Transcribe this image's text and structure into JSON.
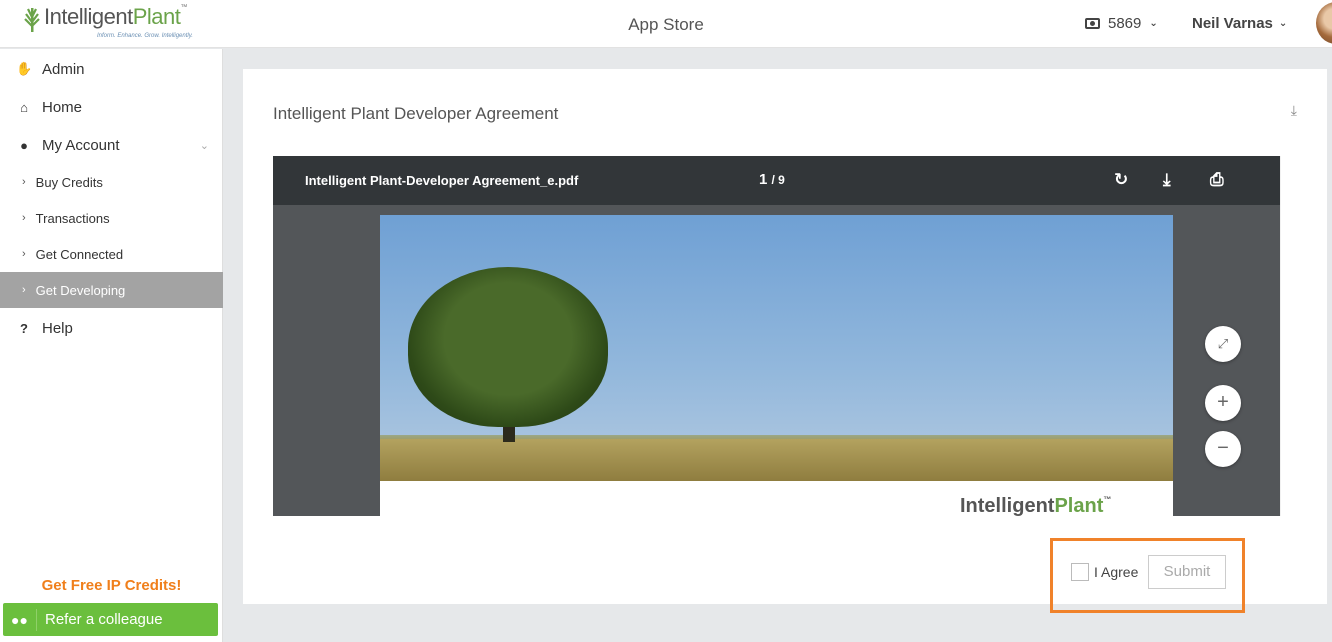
{
  "header": {
    "logo_name_1": "Intelligent",
    "logo_name_2": "Plant",
    "logo_tm": "™",
    "logo_tagline": "Inform. Enhance. Grow. Intelligently.",
    "title": "App Store",
    "credits": "5869",
    "user_name": "Neil Varnas"
  },
  "sidebar": {
    "items": [
      {
        "label": "Admin",
        "icon": "hand-icon"
      },
      {
        "label": "Home",
        "icon": "home-icon"
      },
      {
        "label": "My Account",
        "icon": "user-icon"
      },
      {
        "label": "Buy Credits"
      },
      {
        "label": "Transactions"
      },
      {
        "label": "Get Connected"
      },
      {
        "label": "Get Developing",
        "active": true
      },
      {
        "label": "Help",
        "icon": "question-icon"
      }
    ],
    "promo": "Get Free IP Credits!",
    "refer_label": "Refer a colleague"
  },
  "main": {
    "doc_title": "Intelligent Plant Developer Agreement",
    "viewer": {
      "file_name": "Intelligent Plant-Developer Agreement_e.pdf",
      "current_page": "1",
      "total_pages": "/ 9",
      "page_logo_1": "Intelligent",
      "page_logo_2": "Plant",
      "page_logo_tm": "™"
    },
    "agree_label": "I Agree",
    "submit_label": "Submit"
  },
  "colors": {
    "brand_green": "#6ba34a",
    "promo_orange": "#f07f1b",
    "refer_button": "#6bbf3d",
    "highlight": "#f0822a"
  }
}
